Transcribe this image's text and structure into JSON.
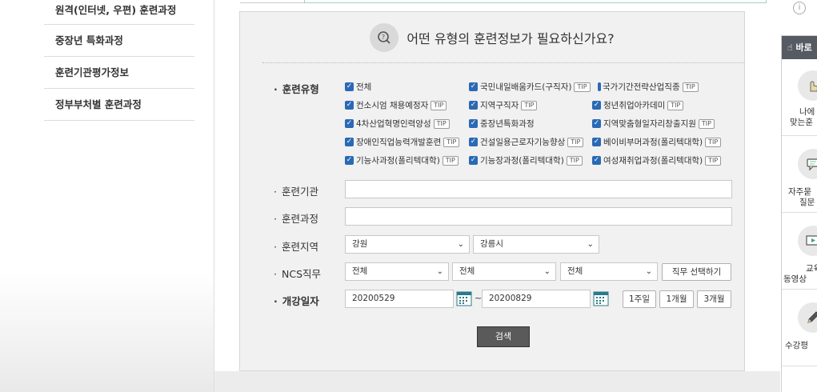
{
  "sidebar": {
    "items": [
      {
        "label": "원격(인터넷, 우편) 훈련과정"
      },
      {
        "label": "중장년 특화과정"
      },
      {
        "label": "훈련기관평가정보"
      },
      {
        "label": "정부부처별 훈련과정"
      }
    ]
  },
  "panel": {
    "title": "어떤 유형의 훈련정보가 필요하신가요?",
    "search_icon": "question-search-icon"
  },
  "form": {
    "type_label": "훈련유형",
    "institution_label": "훈련기관",
    "course_label": "훈련과정",
    "region_label": "훈련지역",
    "ncs_label": "NCS직무",
    "date_label": "개강일자",
    "tip_label": "TIP",
    "checkboxes": [
      {
        "label": "전체",
        "tip": false
      },
      {
        "label": "국민내일배움카드(구직자)",
        "tip": true
      },
      {
        "label": "국가기간전략산업직종",
        "tip": true
      },
      {
        "label": "컨소시엄 채용예정자",
        "tip": true
      },
      {
        "label": "지역구직자",
        "tip": true
      },
      {
        "label": "청년취업아카데미",
        "tip": true
      },
      {
        "label": "4차산업혁명인력양성",
        "tip": true
      },
      {
        "label": "중장년특화과정",
        "tip": false
      },
      {
        "label": "지역맞춤형일자리창출지원",
        "tip": true
      },
      {
        "label": "장애인직업능력개발훈련",
        "tip": true
      },
      {
        "label": "건설일용근로자기능향상",
        "tip": true
      },
      {
        "label": "베이비부머과정(폴리텍대학)",
        "tip": true
      },
      {
        "label": "기능사과정(폴리텍대학)",
        "tip": true
      },
      {
        "label": "기능장과정(폴리텍대학)",
        "tip": true
      },
      {
        "label": "여성재취업과정(폴리텍대학)",
        "tip": true
      }
    ],
    "institution_value": "",
    "course_value": "",
    "region_province": "강원",
    "region_city": "강릉시",
    "ncs_1": "전체",
    "ncs_2": "전체",
    "ncs_3": "전체",
    "ncs_button": "직무 선택하기",
    "date_from": "20200529",
    "date_tilde": "~",
    "date_to": "20200829",
    "period_1w": "1주일",
    "period_1m": "1개월",
    "period_3m": "3개월",
    "search_button": "검색"
  },
  "quick": {
    "title": "바로",
    "items": [
      {
        "line1": "나에",
        "line2": "맞는훈",
        "icon": "hand-touch-icon"
      },
      {
        "line1": "자주묻",
        "line2": "질문",
        "icon": "chat-icon"
      },
      {
        "line1": "교육",
        "line2": "동영상",
        "icon": "video-icon"
      },
      {
        "line1": "수강평",
        "line2": "",
        "icon": "pencil-icon"
      }
    ]
  },
  "colors": {
    "checkbox": "#2a69b5",
    "panel_bg": "#f1f1f1",
    "search_button": "#5a5a5a",
    "quick_head": "#565a62"
  }
}
